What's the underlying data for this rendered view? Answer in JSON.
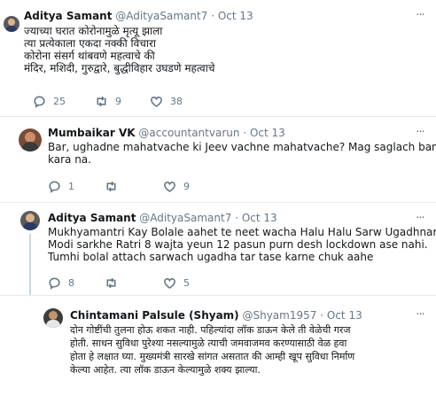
{
  "tweets": [
    {
      "name": "Aditya Samant",
      "handle": "@AdityaSamant7",
      "separator": "·",
      "time": "Oct 13",
      "lines": [
        "ज्याच्या घरात कोरोनामुळे मृत्यू झाला",
        "त्या प्रत्येकाला एकदा नक्की विचारा",
        "कोरोना संसर्ग थांबवणे महत्वाचे की",
        "मंदिर, मशिदी, गुरुद्वारे, बुद्धीविहार उघडणे महत्वाचे"
      ],
      "replies": "25",
      "retweets": "9",
      "likes": "38"
    },
    {
      "name": "Mumbaikar VK",
      "handle": "@accountantvarun",
      "separator": "·",
      "time": "Oct 13",
      "lines": [
        "Bar, ughadne mahatvache ki Jeev vachne mahatvache? Mag saglach band",
        "kara na."
      ],
      "replies": "1",
      "retweets": "",
      "likes": "9"
    },
    {
      "name": "Aditya Samant",
      "handle": "@AdityaSamant7",
      "separator": "·",
      "time": "Oct 13",
      "lines": [
        "Mukhyamantri Kay Bolale aahet te neet wacha Halu Halu Sarw Ugadhnar .",
        "Modi sarkhe Ratri 8 wajta yeun 12 pasun purn desh lockdown ase nahi.",
        "Tumhi bolal attach sarwach ugadha tar tase karne chuk aahe"
      ],
      "replies": "8",
      "retweets": "",
      "likes": "5"
    },
    {
      "name": "Chintamani Palsule (Shyam)",
      "handle": "@Shyam1957",
      "separator": "·",
      "time": "Oct 13",
      "lines": [
        "दोन गोष्टींची तुलना होऊ शकत नाही. पहिल्यांदा लॉक डाऊन केले ती वेळेची गरज",
        "होती. साधन सुविधा पुरेश्या नसल्यामुळे त्याची जमवाजमव करण्यासाठी वेळ हवा",
        "होता हे लक्षात घ्या. मुख्यमंत्री सारखे सांगत असतात की आम्ही खूप सुविधा निर्माण",
        "केल्या आहेत. त्या लॉक डाऊन केल्यामुळे शक्य झाल्या."
      ]
    }
  ],
  "icons": {
    "reply": "reply-icon",
    "retweet": "retweet-icon",
    "like": "like-icon",
    "more": "more-icon"
  },
  "colors": {
    "text": "#14171a",
    "secondary": "#657786",
    "divider": "#e6ecf0",
    "thread_line": "#ccd6dd"
  }
}
